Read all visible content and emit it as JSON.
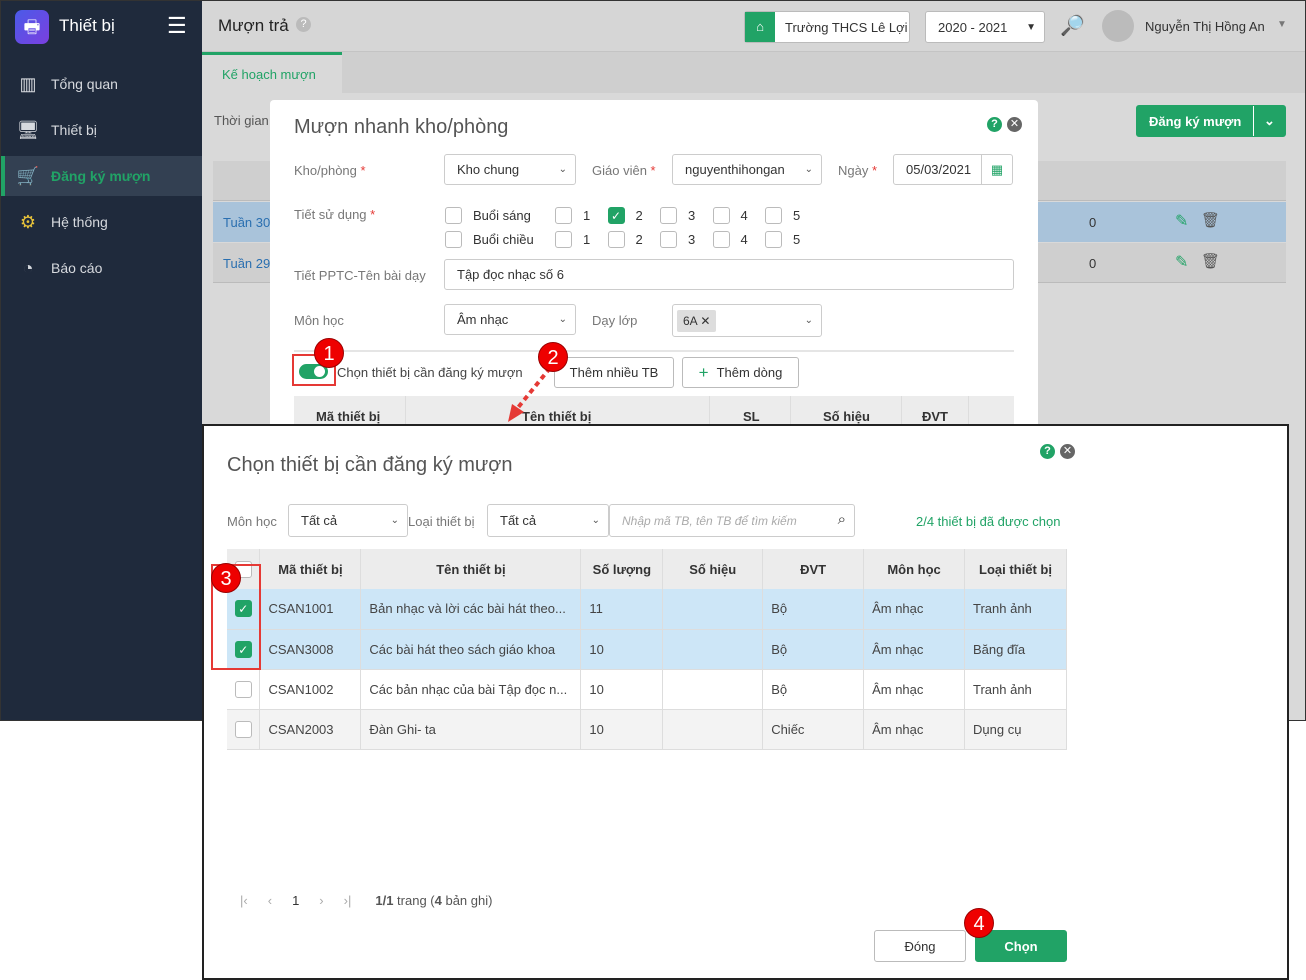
{
  "sidebar": {
    "app_title": "Thiết bị",
    "items": [
      {
        "label": "Tổng quan"
      },
      {
        "label": "Thiết bị"
      },
      {
        "label": "Đăng ký mượn"
      },
      {
        "label": "Hệ thống"
      },
      {
        "label": "Báo cáo"
      }
    ]
  },
  "header": {
    "title": "Mượn trả",
    "help": "?",
    "school": "Trường THCS Lê Lợi",
    "year": "2020 - 2021",
    "user": "Nguyễn Thị Hồng An"
  },
  "tabs": [
    {
      "label": "Kế hoạch mượn"
    }
  ],
  "page": {
    "time_label": "Thời gian",
    "register_button": "Đăng ký mượn",
    "rows": [
      {
        "week": "Tuần 30",
        "count": "0"
      },
      {
        "week": "Tuần 29",
        "count": "0"
      }
    ]
  },
  "quick_modal": {
    "title": "Mượn nhanh kho/phòng",
    "kho_label": "Kho/phòng",
    "kho_value": "Kho chung",
    "teacher_label": "Giáo viên",
    "teacher_value": "nguyenthihongan",
    "date_label": "Ngày",
    "date_value": "05/03/2021",
    "period_label": "Tiết sử dụng",
    "morning": "Buổi sáng",
    "afternoon": "Buổi chiều",
    "periods": [
      "1",
      "2",
      "3",
      "4",
      "5"
    ],
    "lesson_label": "Tiết PPTC-Tên bài dạy",
    "lesson_value": "Tập đọc nhạc số 6",
    "subject_label": "Môn học",
    "subject_value": "Âm nhạc",
    "class_label": "Dạy lớp",
    "class_tag": "6A",
    "toggle_label": "Chọn thiết bị cần đăng ký mượn",
    "add_many": "Thêm nhiều TB",
    "add_row": "Thêm dòng",
    "columns": [
      "Mã thiết bị",
      "Tên thiết bị",
      "SL",
      "Số hiệu",
      "ĐVT"
    ]
  },
  "select_modal": {
    "title": "Chọn thiết bị cần đăng ký mượn",
    "subject_label": "Môn học",
    "subject_value": "Tất cả",
    "type_label": "Loại thiết bị",
    "type_value": "Tất cả",
    "search_placeholder": "Nhập mã TB, tên TB để tìm kiếm",
    "selected_info": "2/4 thiết bị đã được chọn",
    "columns": [
      "Mã thiết bị",
      "Tên thiết bị",
      "Số lượng",
      "Số hiệu",
      "ĐVT",
      "Môn học",
      "Loại thiết bị"
    ],
    "rows": [
      {
        "checked": true,
        "code": "CSAN1001",
        "name": "Bản nhạc và lời các bài hát theo...",
        "qty": "11",
        "serial": "",
        "unit": "Bộ",
        "subject": "Âm nhạc",
        "type": "Tranh ảnh"
      },
      {
        "checked": true,
        "code": "CSAN3008",
        "name": "Các bài hát theo sách giáo khoa",
        "qty": "10",
        "serial": "",
        "unit": "Bộ",
        "subject": "Âm nhạc",
        "type": "Băng đĩa"
      },
      {
        "checked": false,
        "code": "CSAN1002",
        "name": "Các bản nhạc của bài Tập đọc n...",
        "qty": "10",
        "serial": "",
        "unit": "Bộ",
        "subject": "Âm nhạc",
        "type": "Tranh ảnh"
      },
      {
        "checked": false,
        "code": "CSAN2003",
        "name": "Đàn Ghi- ta",
        "qty": "10",
        "serial": "",
        "unit": "Chiếc",
        "subject": "Âm nhạc",
        "type": "Dụng cụ"
      }
    ],
    "page_current": "1",
    "page_info_a": "1/1",
    "page_info_b": " trang (",
    "page_info_c": "4",
    "page_info_d": " bản ghi)",
    "close": "Đóng",
    "choose": "Chọn"
  },
  "badges": [
    "1",
    "2",
    "3",
    "4"
  ],
  "colors": {
    "accent": "#21a366",
    "sidebar": "#1f2a3c",
    "selected_row": "#cde6f7",
    "badge": "#e00000"
  }
}
